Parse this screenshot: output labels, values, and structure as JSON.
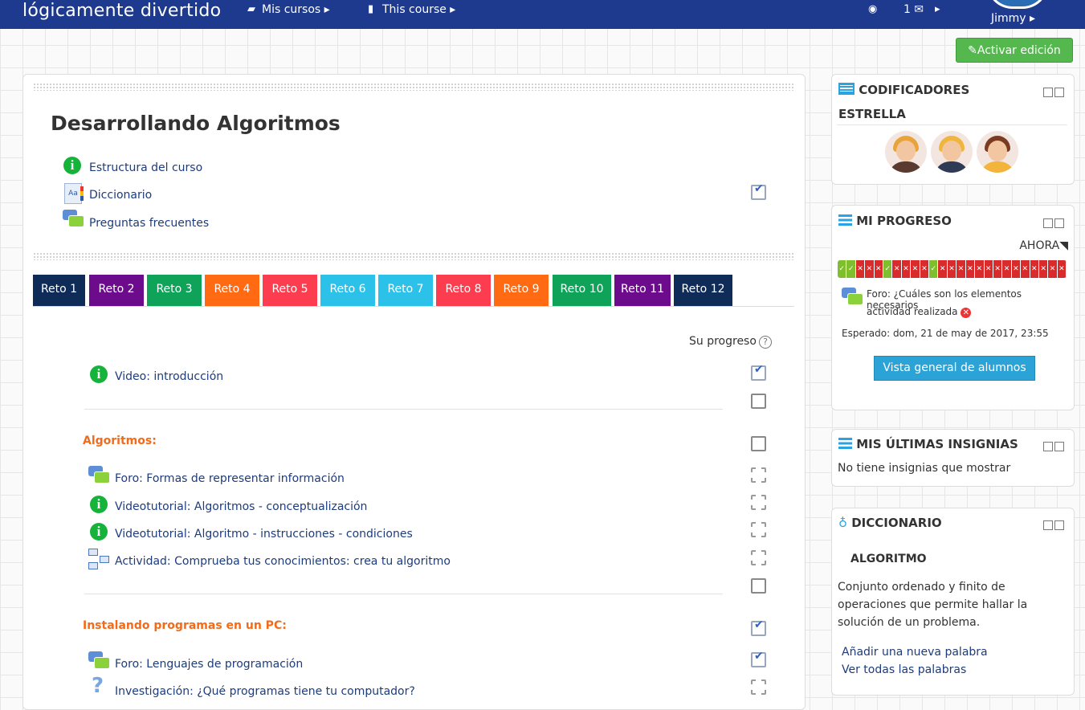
{
  "navbar": {
    "brand": "lógicamente divertido",
    "mis_cursos": "Mis cursos",
    "this_course": "This course",
    "message_count": "1",
    "user": "Jimmy"
  },
  "edit_button": "Activar edición",
  "course": {
    "title": "Desarrollando Algoritmos",
    "top_items": [
      "Estructura del curso",
      "Diccionario",
      "Preguntas frecuentes"
    ],
    "tabs": [
      {
        "label": "Reto 1",
        "color": "#0f2b57"
      },
      {
        "label": "Reto 2",
        "color": "#6c0c8c"
      },
      {
        "label": "Reto 3",
        "color": "#0fa359"
      },
      {
        "label": "Reto 4",
        "color": "#ff6a13"
      },
      {
        "label": "Reto 5",
        "color": "#fc3d4f"
      },
      {
        "label": "Reto 6",
        "color": "#2bc1e8"
      },
      {
        "label": "Reto 7",
        "color": "#2bc1e8"
      },
      {
        "label": "Reto 8",
        "color": "#fc3d4f"
      },
      {
        "label": "Reto 9",
        "color": "#ff6a13"
      },
      {
        "label": "Reto 10",
        "color": "#0fa359"
      },
      {
        "label": "Reto 11",
        "color": "#6c0c8c"
      },
      {
        "label": "Reto 12",
        "color": "#0f2b57"
      }
    ],
    "progress_label": "Su progreso",
    "intro_activity": "Video: introducción",
    "sections": [
      {
        "title": "Algoritmos:",
        "activities": [
          "Foro: Formas de representar información",
          "Videotutorial: Algoritmos - conceptualización",
          "Videotutorial: Algoritmo - instrucciones - condiciones",
          "Actividad: Comprueba tus conocimientos: crea tu algoritmo"
        ]
      },
      {
        "title": "Instalando programas en un PC:",
        "activities": [
          "Foro: Lenguajes de programación",
          "Investigación: ¿Qué programas tiene tu computador?"
        ]
      }
    ]
  },
  "blocks": {
    "codificadores": {
      "title": "CODIFICADORES",
      "subtitle": "ESTRELLA"
    },
    "progreso": {
      "title": "MI PROGRESO",
      "ahora": "AHORA",
      "cells": [
        1,
        1,
        0,
        0,
        0,
        1,
        0,
        0,
        0,
        0,
        1,
        0,
        0,
        0,
        0,
        0,
        0,
        0,
        0,
        0,
        0,
        0,
        0,
        0,
        0
      ],
      "forum_text": "Foro: ¿Cuáles son los elementos necesarios",
      "status_text": "actividad realizada",
      "expected": "Esperado: dom, 21 de may de 2017, 23:55",
      "button": "Vista general de alumnos"
    },
    "insignias": {
      "title": "MIS ÚLTIMAS INSIGNIAS",
      "text": "No tiene insignias que mostrar"
    },
    "diccionario": {
      "title": "DICCIONARIO",
      "word": "ALGORITMO",
      "definition_1": "Conjunto ordenado y finito de",
      "definition_2": "operaciones que permite hallar la",
      "definition_3": "solución de un problema.",
      "add_link": "Añadir una nueva palabra",
      "all_link": "Ver todas las palabras"
    }
  }
}
